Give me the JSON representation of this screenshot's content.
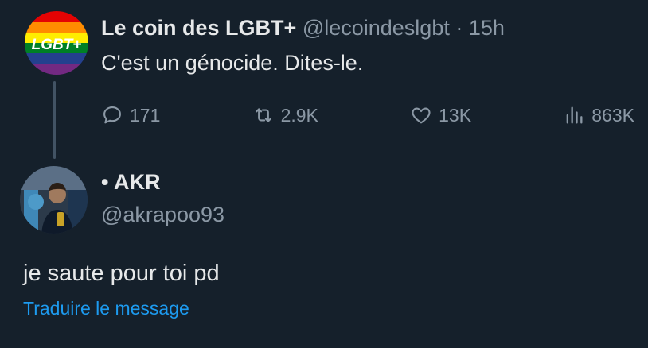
{
  "tweet": {
    "avatar_text": "LGBT+",
    "author_name": "Le coin des LGBT+",
    "handle": "@lecoindeslgbt",
    "separator": "·",
    "time": "15h",
    "text": "C'est un génocide. Dites-le.",
    "actions": {
      "reply_count": "171",
      "retweet_count": "2.9K",
      "like_count": "13K",
      "views_count": "863K"
    }
  },
  "reply": {
    "avatar_icon": "user-photo",
    "name": "• AKR",
    "handle": "@akrapoo93",
    "text": "je saute pour toi pd",
    "translate_label": "Traduire le message"
  },
  "colors": {
    "background": "#15202b",
    "text": "#e7e9ea",
    "muted": "#8b98a5",
    "link": "#1d9bf0",
    "thread_line": "#425364"
  }
}
